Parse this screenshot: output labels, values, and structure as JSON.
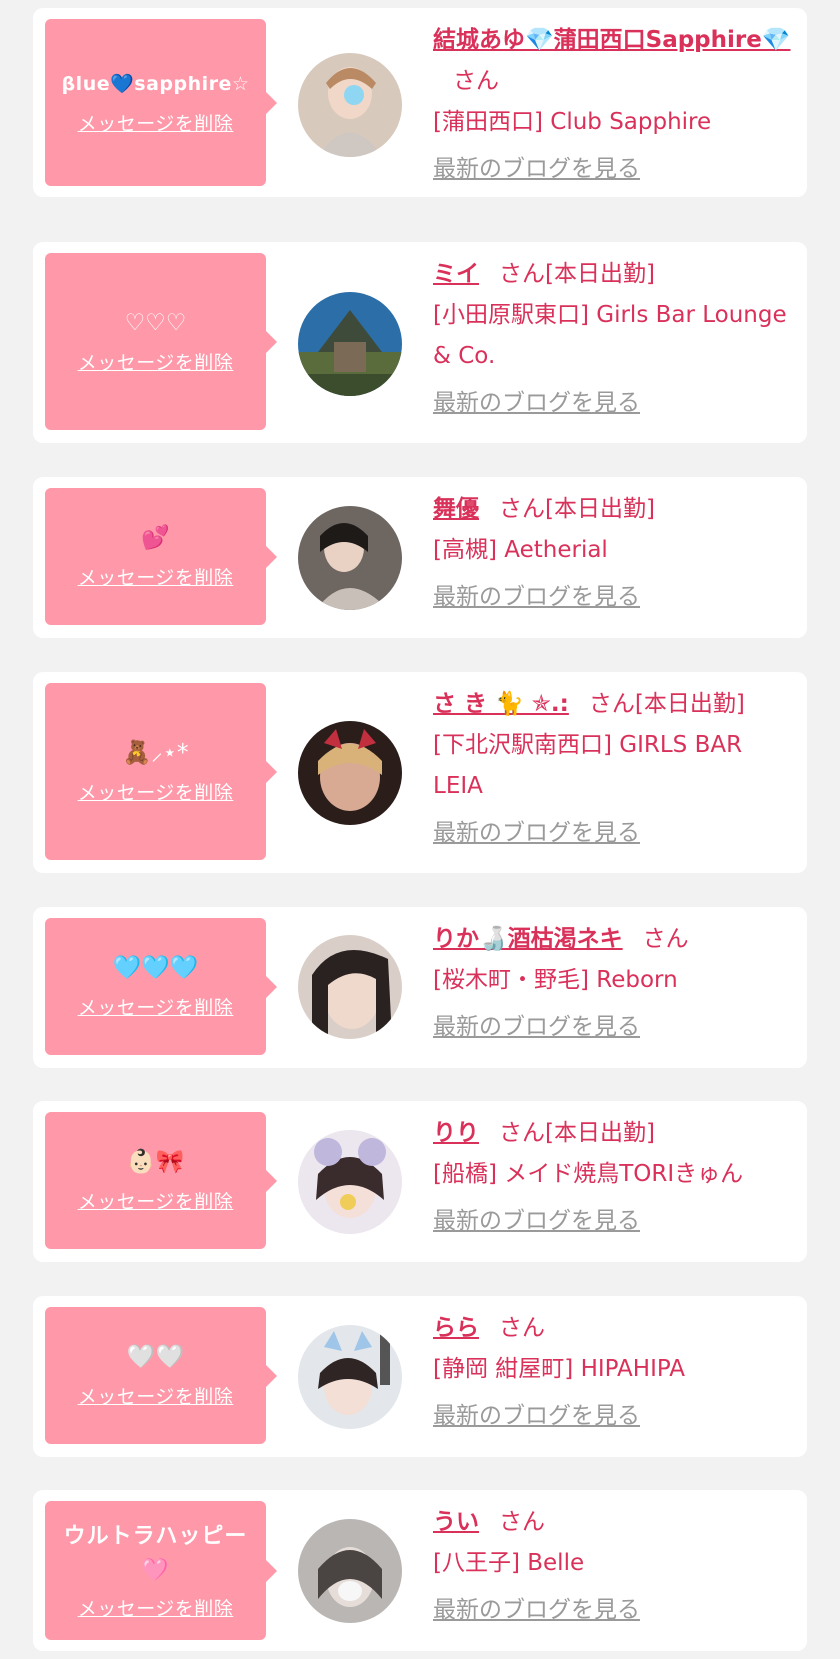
{
  "common": {
    "delete_label": "メッセージを削除",
    "san_label": "さん",
    "blog_label": "最新のブログを見る"
  },
  "colors": {
    "bubble": "#ff98a8",
    "accent": "#d9315a",
    "blog_link": "#9a9a9a",
    "page_bg": "#f2f2f2"
  },
  "messages": [
    {
      "message": "βlue💙sapphire☆",
      "name": "結城あゆ💎蒲田西口Sapphire💎",
      "status": "",
      "shop": "[蒲田西口] Club Sapphire"
    },
    {
      "message": "♡♡♡",
      "name": "ミイ",
      "status": "[本日出勤]",
      "shop": "[小田原駅東口] Girls Bar Lounge & Co."
    },
    {
      "message": "💕",
      "name": "舞優",
      "status": "[本日出勤]",
      "shop": "[高槻] Aetherial"
    },
    {
      "message": "🧸⸝⋆*",
      "name": "さ き 🐈 ✯.:",
      "status": "[本日出勤]",
      "shop": "[下北沢駅南西口] GIRLS BAR LEIA"
    },
    {
      "message": "🩵🩵🩵",
      "name": "りか🍶酒枯渇ネキ",
      "status": "",
      "shop": "[桜木町・野毛] Reborn"
    },
    {
      "message": "👶🏻🎀",
      "name": "りり",
      "status": "[本日出勤]",
      "shop": "[船橋] メイド焼鳥TORIきゅん"
    },
    {
      "message": "🤍🤍",
      "name": "らら",
      "status": "",
      "shop": "[静岡 紺屋町] HIPAHIPA"
    },
    {
      "message": "ウルトラハッピー🩷",
      "name": "うい",
      "status": "",
      "shop": "[八王子] Belle"
    }
  ]
}
